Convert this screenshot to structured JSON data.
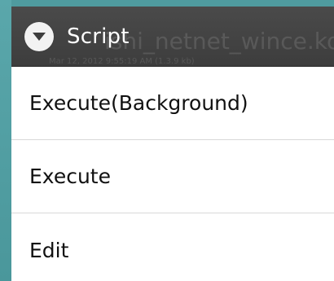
{
  "dialog": {
    "title": "Script",
    "title_icon": "chevron-down-circle-icon",
    "ghost_filename": "ishi_netnet_wince.ko",
    "ghost_meta": "Mar 12, 2012 9:55:19 AM  (1.3.9 kb)",
    "items": [
      {
        "label": "Execute(Background)"
      },
      {
        "label": "Execute"
      },
      {
        "label": "Edit"
      }
    ]
  },
  "colors": {
    "title_bar": "#3d3d3d",
    "list_background": "#ffffff",
    "backdrop": "#4f9b9f"
  }
}
